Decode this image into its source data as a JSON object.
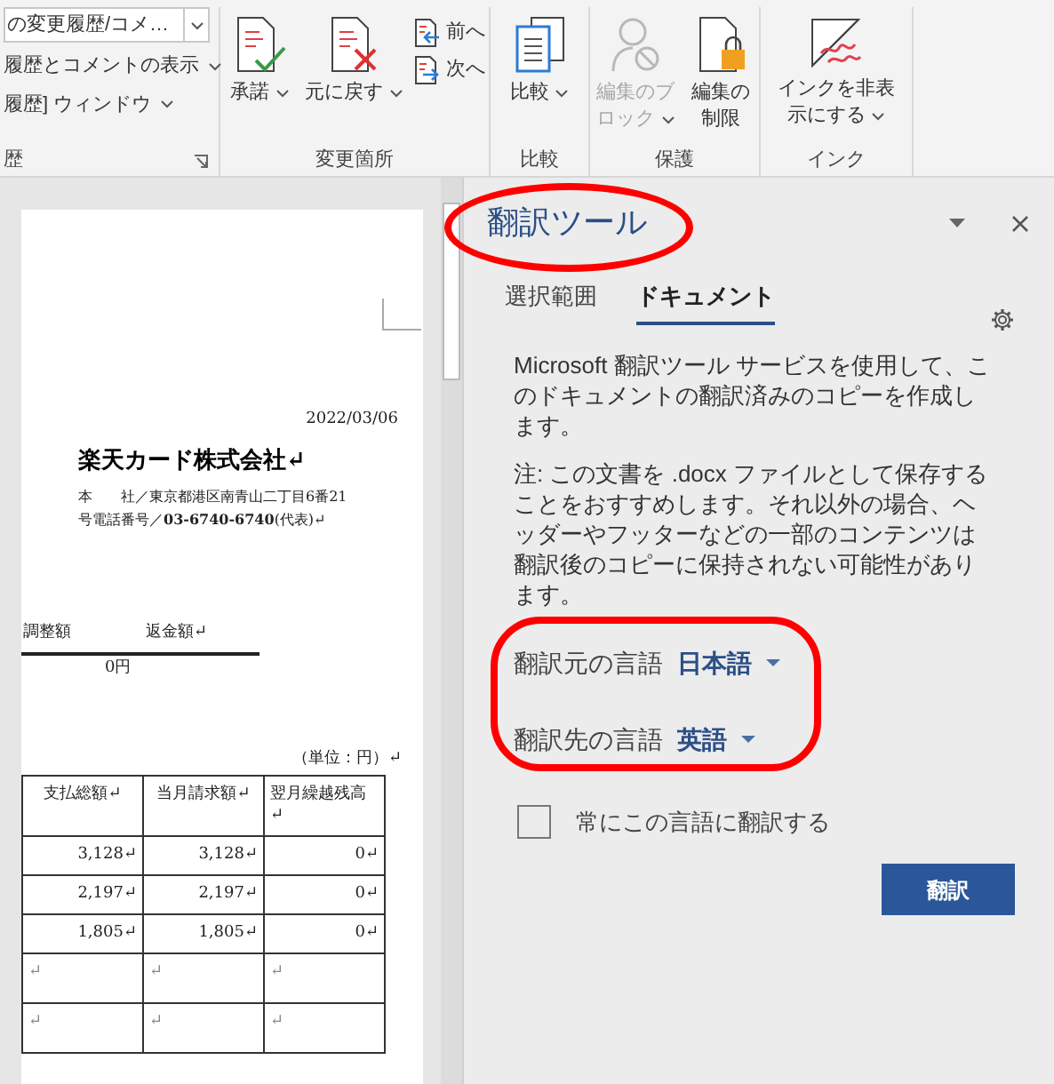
{
  "ribbon": {
    "groups": [
      {
        "label": "歴",
        "launcher": true,
        "items": [
          {
            "kind": "combo",
            "label": "の変更履歴/コメ…"
          },
          {
            "kind": "menu",
            "label": "履歴とコメントの表示"
          },
          {
            "kind": "menu",
            "label": "履歴] ウィンドウ"
          }
        ]
      },
      {
        "label": "変更箇所",
        "launcher": false,
        "items": [
          {
            "kind": "big",
            "label": "承諾",
            "menu": true,
            "disabled": false
          },
          {
            "kind": "big",
            "label": "元に戻す",
            "menu": true,
            "disabled": false
          },
          {
            "kind": "stack",
            "buttons": [
              {
                "label": "前へ"
              },
              {
                "label": "次へ"
              }
            ]
          }
        ]
      },
      {
        "label": "比較",
        "launcher": false,
        "items": [
          {
            "kind": "big",
            "label": "比較",
            "menu": true,
            "disabled": false
          }
        ]
      },
      {
        "label": "保護",
        "launcher": false,
        "items": [
          {
            "kind": "big",
            "label": "編集のブロック",
            "menu": true,
            "disabled": true
          },
          {
            "kind": "big",
            "label": "編集の制限",
            "menu": false,
            "disabled": false
          }
        ]
      },
      {
        "label": "インク",
        "launcher": false,
        "items": [
          {
            "kind": "big",
            "label": "インクを非表示にする",
            "menu": true,
            "disabled": false
          }
        ]
      }
    ]
  },
  "document": {
    "date": "2022/03/06",
    "company": "楽天カード株式会社↵",
    "address_lines": [
      "本　　社／東京都港区南青山二丁目6番21",
      "号電話番号／**03-6740-6740**(代表)↵"
    ],
    "summary": {
      "labels": [
        "調整額",
        "返金額↵"
      ],
      "value": "0円"
    },
    "unit_note": "（単位：円）↵",
    "table": {
      "columns": [
        "支払総額↵",
        "当月請求額↵",
        "翌月繰越残高↵"
      ],
      "rows": [
        [
          "3,128↵",
          "3,128↵",
          "0↵"
        ],
        [
          "2,197↵",
          "2,197↵",
          "0↵"
        ],
        [
          "1,805↵",
          "1,805↵",
          "0↵"
        ],
        [
          "↵",
          "↵",
          "↵"
        ],
        [
          "↵",
          "↵",
          "↵"
        ]
      ]
    }
  },
  "pane": {
    "title": "翻訳ツール",
    "tabs": [
      {
        "label": "選択範囲",
        "selected": false
      },
      {
        "label": "ドキュメント",
        "selected": true
      }
    ],
    "paragraphs": [
      "Microsoft 翻訳ツール サービスを使用して、このドキュメントの翻訳済みのコピーを作成します。",
      "注: この文書を .docx ファイルとして保存することをおすすめします。それ以外の場合、ヘッダーやフッターなどの一部のコンテンツは翻訳後のコピーに保持されない可能性があります。"
    ],
    "languages": [
      {
        "label": "翻訳元の言語",
        "value": "日本語"
      },
      {
        "label": "翻訳先の言語",
        "value": "英語"
      }
    ],
    "always_translate": {
      "label": "常にこの言語に翻訳する",
      "checked": false
    },
    "translate_button": "翻訳"
  }
}
